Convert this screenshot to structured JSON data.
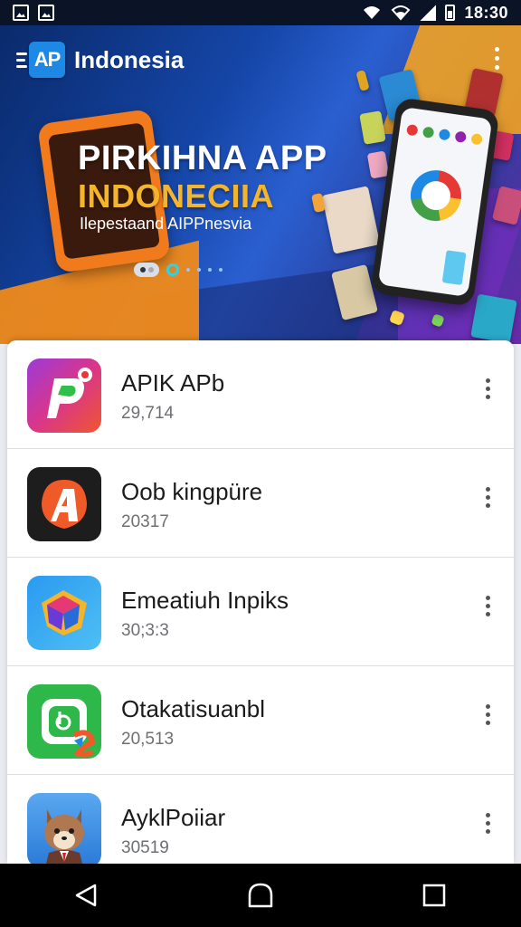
{
  "status_bar": {
    "time": "18:30",
    "icons": [
      "image-notification-icon",
      "photo-notification-icon",
      "wifi-icon",
      "wifi-alt-icon",
      "signal-icon",
      "battery-icon"
    ]
  },
  "app_bar": {
    "logo_text": "AP",
    "title": "Indonesia"
  },
  "hero": {
    "line1": "PIRKIHNA APP",
    "line2": "INDONECIIA",
    "line3": "Ilepestaand AIPPnesvia"
  },
  "apps": [
    {
      "name": "APIK APb",
      "size": "29,714",
      "icon": "p-logo-icon"
    },
    {
      "name": "Oob kingpüre",
      "size": "20317",
      "icon": "a-logo-icon"
    },
    {
      "name": "Emeatiuh Inpiks",
      "size": "30;3:3",
      "icon": "gem-logo-icon"
    },
    {
      "name": "Otakatisuanbl",
      "size": "20,513",
      "icon": "b-logo-icon"
    },
    {
      "name": "AyklPoiiar",
      "size": "30519",
      "icon": "fox-avatar-icon"
    }
  ],
  "colors": {
    "hero_orange": "#f08a1a",
    "hero_blue": "#1546a8",
    "headline_yellow": "#f5b52a",
    "nav_bg": "#000000"
  }
}
